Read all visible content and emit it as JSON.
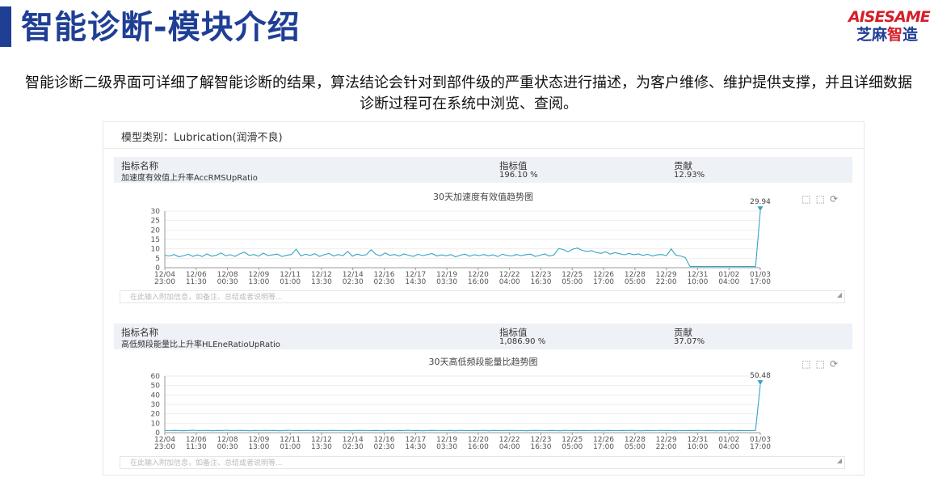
{
  "page": {
    "title": "智能诊断-模块介绍",
    "logo_top": "AISESAME",
    "logo_bottom_a": "芝麻",
    "logo_bottom_b": "智",
    "logo_bottom_c": "造",
    "description": "智能诊断二级界面可详细了解智能诊断的结果，算法结论会针对到部件级的严重状态进行描述，为客户维修、维护提供支撑，并且详细数据诊断过程可在系统中浏览、查阅。"
  },
  "panel": {
    "model_label": "模型类别：Lubrication(润滑不良)",
    "note_placeholder": "在此输入附加信息，如备注、总结或者说明等..."
  },
  "indicators": [
    {
      "col_name": "指标名称",
      "col_value": "指标值",
      "col_contrib": "贡献",
      "name": "加速度有效值上升率AccRMSUpRatio",
      "value": "196.10 %",
      "contrib": "12.93%"
    },
    {
      "col_name": "指标名称",
      "col_value": "指标值",
      "col_contrib": "贡献",
      "name": "高低频段能量比上升率HLEneRatioUpRatio",
      "value": "1,086.90 %",
      "contrib": "37.07%"
    }
  ],
  "icons": [
    "zoom-area-icon",
    "zoom-reset-icon",
    "restore-icon",
    "resize-grip-icon"
  ],
  "colors": {
    "line": "#38a3c2",
    "title": "#1f3f95",
    "accent_red": "#d51e2b",
    "table_bg": "#eef1f6"
  },
  "chart_data": [
    {
      "type": "line",
      "title": "30天加速度有效值趋势图",
      "x_ticks": [
        "12/04\n23:00",
        "12/06\n11:30",
        "12/08\n00:30",
        "12/09\n13:00",
        "12/11\n01:00",
        "12/12\n13:30",
        "12/14\n02:30",
        "12/16\n02:30",
        "12/17\n14:30",
        "12/19\n03:30",
        "12/20\n16:00",
        "12/22\n04:00",
        "12/23\n16:30",
        "12/25\n05:00",
        "12/26\n17:00",
        "12/28\n05:00",
        "12/29\n22:00",
        "12/31\n10:00",
        "01/02\n04:00",
        "01/03\n17:00"
      ],
      "y_ticks": [
        0,
        5,
        10,
        15,
        20,
        25,
        30
      ],
      "ylim": [
        0,
        30
      ],
      "max_label": "29.94",
      "values": [
        6.5,
        6.2,
        7.0,
        5.8,
        6.4,
        7.1,
        6.0,
        6.8,
        5.9,
        7.3,
        6.1,
        6.6,
        7.8,
        6.3,
        6.9,
        6.0,
        7.4,
        8.2,
        6.5,
        7.0,
        6.1,
        7.7,
        6.4,
        6.8,
        7.2,
        5.9,
        6.6,
        7.0,
        9.8,
        6.3,
        7.1,
        6.5,
        7.4,
        6.0,
        6.9,
        7.6,
        6.2,
        7.0,
        6.4,
        8.6,
        6.1,
        7.2,
        6.5,
        6.9,
        9.5,
        7.1,
        6.3,
        7.8,
        6.5,
        7.0,
        6.2,
        7.3,
        6.6,
        6.0,
        7.1,
        6.4,
        6.9,
        7.5,
        6.2,
        6.8,
        6.3,
        7.0,
        5.8,
        6.6,
        7.2,
        6.1,
        6.9,
        6.4,
        7.0,
        6.3,
        6.8,
        5.9,
        7.1,
        6.5,
        6.2,
        7.0,
        6.4,
        6.9,
        7.2,
        6.0,
        6.6,
        7.3,
        6.2,
        6.8,
        10.2,
        9.6,
        8.4,
        9.8,
        10.4,
        9.2,
        8.6,
        9.0,
        8.1,
        7.6,
        8.4,
        7.2,
        8.0,
        7.4,
        6.8,
        7.6,
        6.9,
        7.3,
        6.5,
        7.1,
        6.2,
        6.8,
        7.0,
        6.4,
        10.0,
        6.6,
        6.2,
        5.4,
        0.6,
        0.6,
        0.6,
        0.6,
        0.6,
        0.6,
        0.6,
        0.6,
        0.6,
        0.6,
        0.6,
        0.6,
        0.6,
        0.6,
        0.6,
        29.94
      ]
    },
    {
      "type": "line",
      "title": "30天高低频段能量比趋势图",
      "x_ticks": [
        "12/04\n23:00",
        "12/06\n11:30",
        "12/08\n00:30",
        "12/09\n13:00",
        "12/11\n01:00",
        "12/12\n13:30",
        "12/14\n02:30",
        "12/16\n02:30",
        "12/17\n14:30",
        "12/19\n03:30",
        "12/20\n16:00",
        "12/22\n04:00",
        "12/23\n16:30",
        "12/25\n05:00",
        "12/26\n17:00",
        "12/28\n05:00",
        "12/29\n22:00",
        "12/31\n10:00",
        "01/02\n04:00",
        "01/03\n17:00"
      ],
      "y_ticks": [
        0,
        10,
        20,
        30,
        40,
        50,
        60
      ],
      "ylim": [
        0,
        60
      ],
      "max_label": "50.48",
      "values": [
        2.3,
        2.1,
        2.4,
        2.2,
        2.0,
        2.3,
        2.5,
        2.1,
        2.2,
        2.4,
        2.0,
        2.3,
        2.2,
        2.5,
        2.1,
        2.3,
        2.4,
        2.2,
        2.0,
        2.3,
        2.1,
        2.4,
        2.2,
        2.3,
        2.0,
        2.2,
        2.5,
        2.1,
        2.3,
        2.2,
        2.4,
        2.0,
        2.3,
        2.1,
        2.2,
        2.4,
        2.3,
        2.1,
        2.2,
        2.0,
        2.3,
        2.4,
        2.2,
        2.1,
        2.3,
        2.2,
        2.0,
        2.4,
        2.1,
        2.3,
        2.2,
        2.5,
        2.1,
        2.3,
        2.0,
        2.2,
        2.4,
        2.3,
        2.1,
        2.2,
        2.3,
        2.0,
        2.4,
        2.2,
        2.1,
        2.3,
        2.2,
        2.4,
        2.0,
        2.3,
        2.1,
        2.2,
        2.4,
        2.3,
        2.1,
        2.2,
        2.0,
        2.3,
        2.4,
        2.2,
        2.1,
        2.3,
        2.2,
        2.0,
        2.4,
        2.1,
        2.3,
        2.2,
        2.3,
        2.1,
        2.2,
        2.4,
        2.0,
        2.3,
        2.2,
        2.1,
        2.3,
        2.2,
        2.4,
        2.1,
        2.0,
        2.3,
        2.2,
        2.1,
        2.4,
        2.2,
        2.3,
        2.0,
        2.2,
        2.1,
        2.3,
        2.2,
        2.4,
        2.1,
        2.3,
        2.2,
        2.0,
        2.3,
        2.1,
        2.4,
        2.2,
        2.3,
        2.1,
        2.2,
        2.3,
        50.48
      ]
    }
  ]
}
